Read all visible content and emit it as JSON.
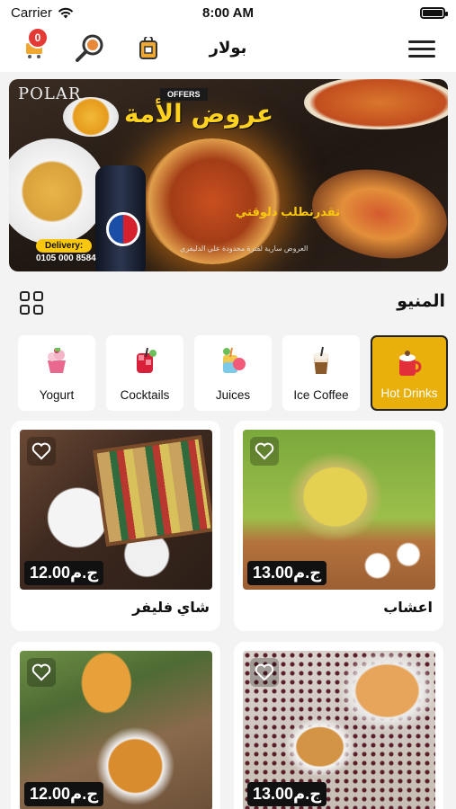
{
  "status_bar": {
    "carrier": "Carrier",
    "time": "8:00 AM"
  },
  "header": {
    "title": "بولار",
    "cart_count": "0"
  },
  "banner": {
    "logo": "POLAR",
    "offers_tag": "OFFERS",
    "title": "عروض الأمة",
    "subtitle": "تقدرنطلب دلوقتي",
    "delivery_label": "Delivery:",
    "phone": "0105 000 8584",
    "note": "العروض سارية لفترة محدودة علي الدليفري"
  },
  "section": {
    "title": "المنيو"
  },
  "categories": [
    {
      "label": "Yogurt",
      "icon": "yogurt-icon",
      "active": false
    },
    {
      "label": "Cocktails",
      "icon": "cocktail-icon",
      "active": false
    },
    {
      "label": "Juices",
      "icon": "juice-icon",
      "active": false
    },
    {
      "label": "Ice Coffee",
      "icon": "ice-coffee-icon",
      "active": false
    },
    {
      "label": "Hot Drinks",
      "icon": "hot-drink-icon",
      "active": true
    }
  ],
  "products": [
    {
      "name": "شاي فليفر",
      "price": "12.00ج.م"
    },
    {
      "name": "اعشاب",
      "price": "13.00ج.م"
    },
    {
      "name": "",
      "price": "12.00ج.م"
    },
    {
      "name": "",
      "price": "13.00ج.م"
    }
  ],
  "colors": {
    "accent": "#e9b00c",
    "badge": "#e53935",
    "price_bg": "#111111"
  }
}
